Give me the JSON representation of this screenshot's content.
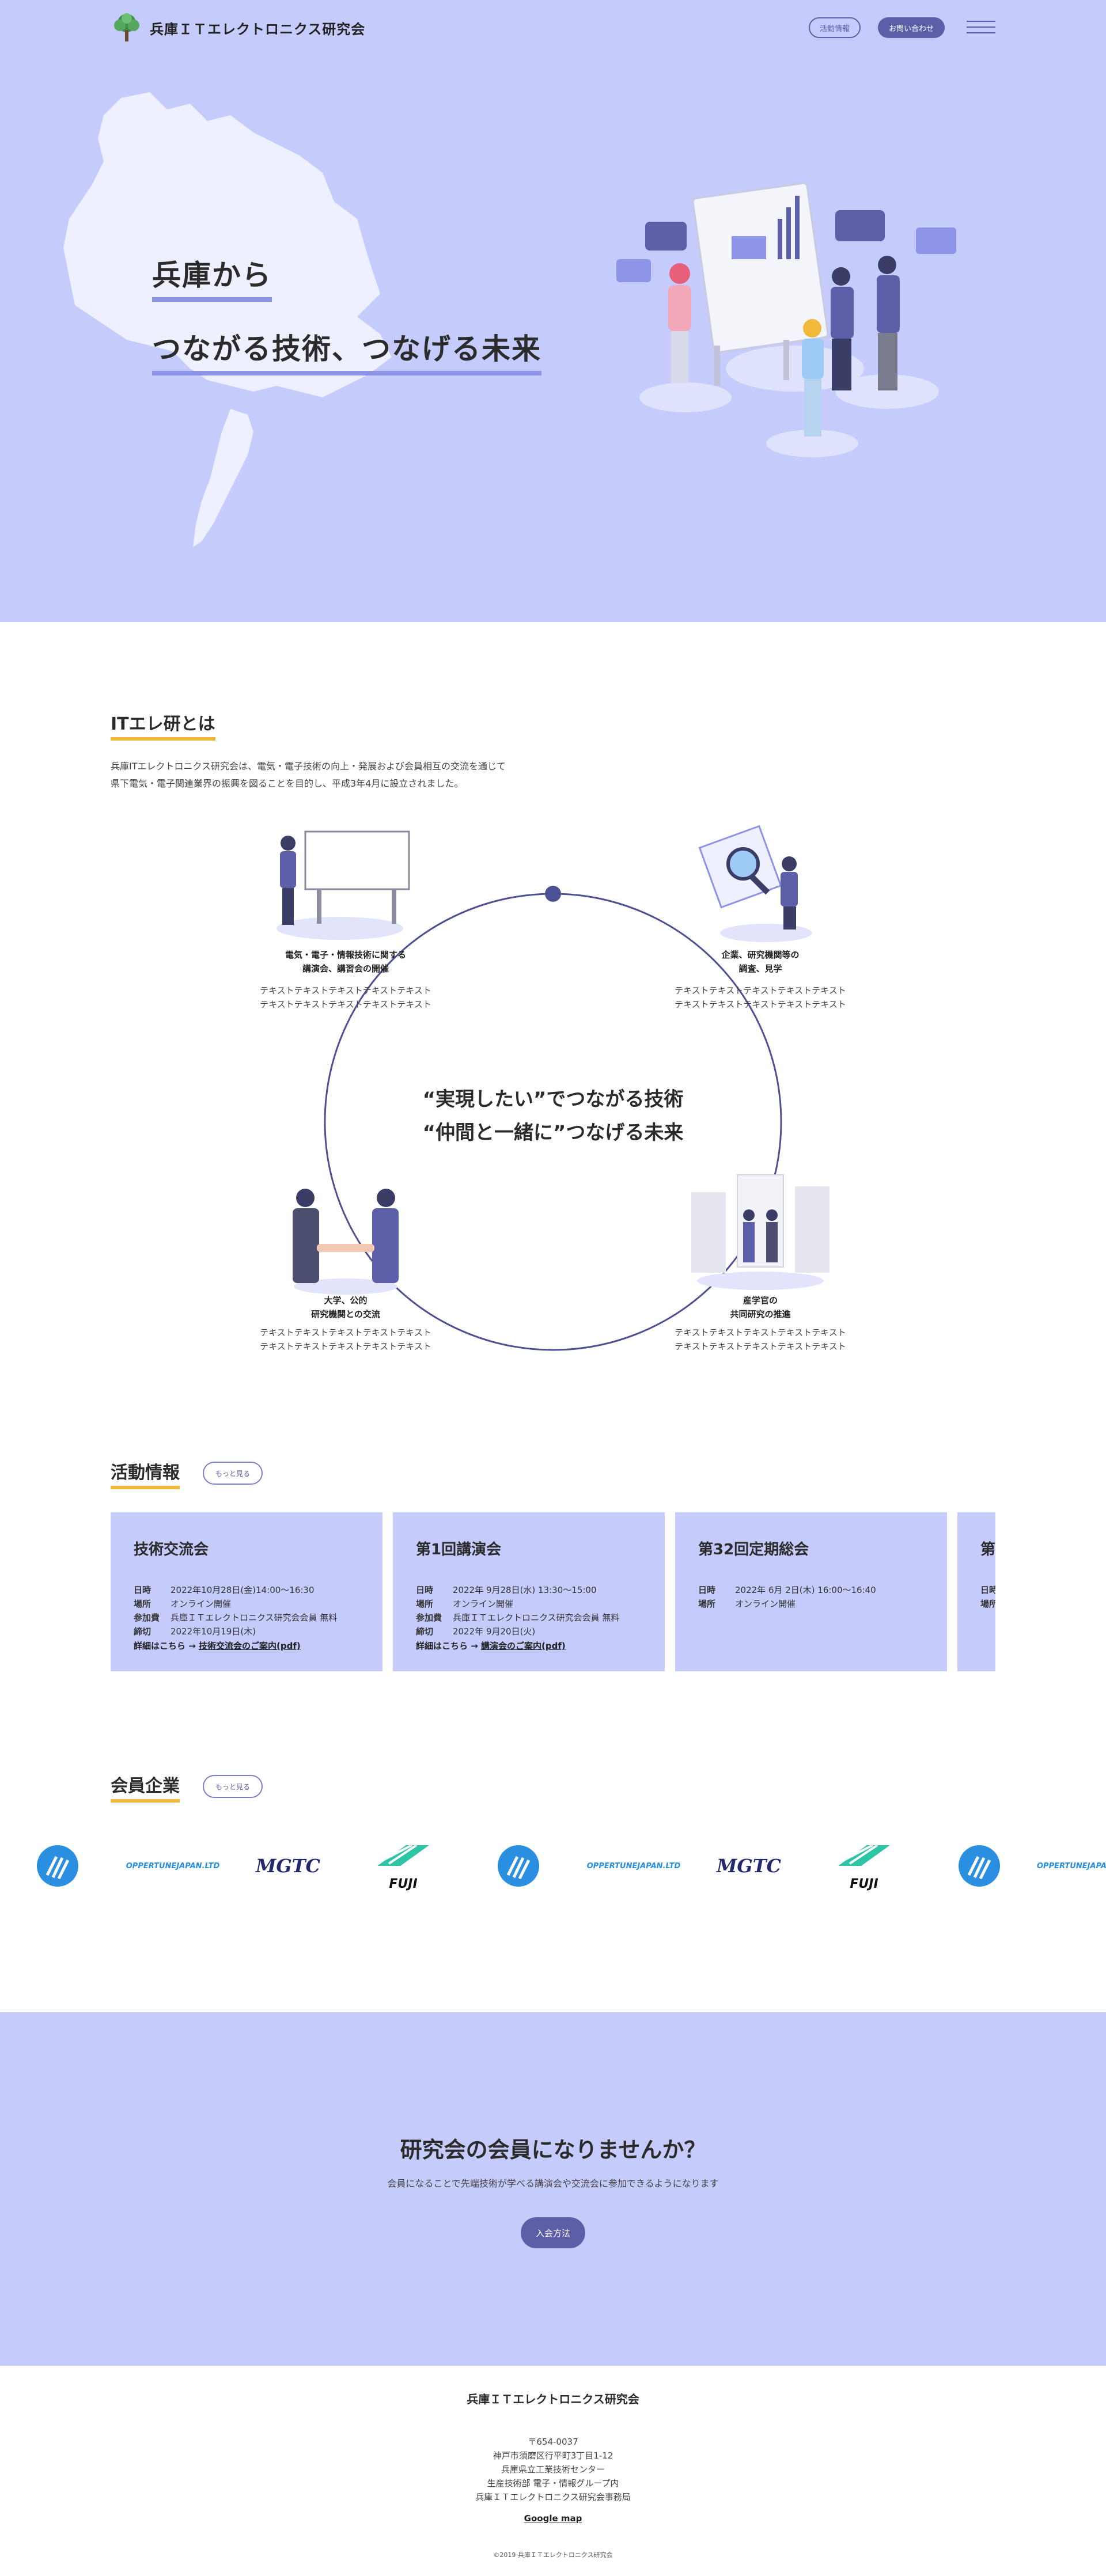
{
  "header": {
    "site_name": "兵庫ＩＴエレクトロニクス研究会",
    "nav_activity": "活動情報",
    "nav_contact": "お問い合わせ"
  },
  "hero": {
    "line1": "兵庫から",
    "line2": "つながる技術、つなげる未来"
  },
  "about": {
    "title": "ITエレ研とは",
    "desc1": "兵庫ITエレクトロニクス研究会は、電気・電子技術の向上・発展および会員相互の交流を通じて",
    "desc2": "県下電気・電子関連業界の振興を図ることを目的し、平成3年4月に設立されました。",
    "center_line1": "“実現したい”でつながる技術",
    "center_line2": "“仲間と一緒に”つなげる未来",
    "features": [
      {
        "title1": "電気・電子・情報技術に関する",
        "title2": "講演会、講習会の開催",
        "text1": "テキストテキストテキストテキストテキスト",
        "text2": "テキストテキストテキストテキストテキスト"
      },
      {
        "title1": "企業、研究機関等の",
        "title2": "調査、見学",
        "text1": "テキストテキストテキストテキストテキスト",
        "text2": "テキストテキストテキストテキストテキスト"
      },
      {
        "title1": "大学、公的",
        "title2": "研究機関との交流",
        "text1": "テキストテキストテキストテキストテキスト",
        "text2": "テキストテキストテキストテキストテキスト"
      },
      {
        "title1": "産学官の",
        "title2": "共同研究の推進",
        "text1": "テキストテキストテキストテキストテキスト",
        "text2": "テキストテキストテキストテキストテキスト"
      }
    ]
  },
  "activity": {
    "title": "活動情報",
    "more": "もっと見る",
    "cards": [
      {
        "title": "技術交流会",
        "rows": [
          [
            "日時",
            "2022年10月28日(金)14:00〜16:30"
          ],
          [
            "場所",
            "オンライン開催"
          ],
          [
            "参加費",
            "兵庫ＩＴエレクトロニクス研究会会員 無料"
          ],
          [
            "締切",
            "2022年10月19日(木)"
          ]
        ],
        "link_prefix": "詳細はこちら → ",
        "link_text": "技術交流会のご案内(pdf)"
      },
      {
        "title": "第1回講演会",
        "rows": [
          [
            "日時",
            "2022年 9月28日(水) 13:30〜15:00"
          ],
          [
            "場所",
            "オンライン開催"
          ],
          [
            "参加費",
            "兵庫ＩＴエレクトロニクス研究会会員 無料"
          ],
          [
            "締切",
            "2022年 9月20日(火)"
          ]
        ],
        "link_prefix": "詳細はこちら → ",
        "link_text": "講演会のご案内(pdf)"
      },
      {
        "title": "第32回定期総会",
        "rows": [
          [
            "日時",
            "2022年 6月 2日(木) 16:00〜16:40"
          ],
          [
            "場所",
            "オンライン開催"
          ]
        ]
      },
      {
        "title": "第",
        "rows": [
          [
            "日時",
            ""
          ],
          [
            "場所",
            ""
          ]
        ]
      }
    ]
  },
  "members": {
    "title": "会員企業",
    "more": "もっと見る",
    "logos": [
      "",
      "OPPERTUNEJAPAN.LTD",
      "MGTC",
      "FUJI",
      "",
      "OPPERTUNEJAPAN.LTD",
      "MGTC",
      "FUJI",
      "",
      "OPPERTUNEJAPAN"
    ]
  },
  "cta": {
    "title": "研究会の会員になりませんか？",
    "sub": "会員になることで先端技術が学べる講演会や交流会に参加できるようになります",
    "button": "入会方法"
  },
  "footer": {
    "name": "兵庫ＩＴエレクトロニクス研究会",
    "addr1": "〒654-0037",
    "addr2": "神戸市須磨区行平町3丁目1-12",
    "addr3": "兵庫県立工業技術センター",
    "addr4": "生産技術部 電子・情報グループ内",
    "addr5": "兵庫ＩＴエレクトロニクス研究会事務局",
    "map": "Google map",
    "copyright": "©2019 兵庫ＩＴエレクトロニクス研究会"
  },
  "colors": {
    "accent": "#5c5fa8",
    "hero_bg": "#c5cbfb",
    "underline_yellow": "#f0b93a",
    "underline_purple": "#8d93e6"
  }
}
